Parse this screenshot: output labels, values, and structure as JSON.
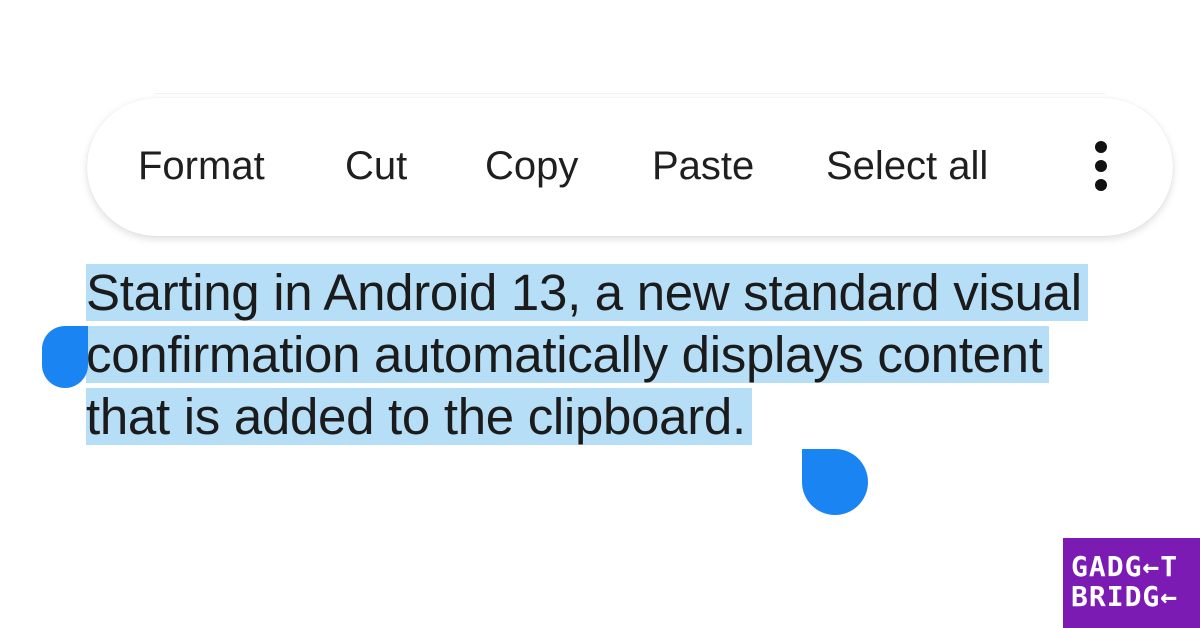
{
  "toolbar": {
    "buttons": [
      "Format",
      "Cut",
      "Copy",
      "Paste",
      "Select all"
    ],
    "overflow_icon": "more-vert-icon"
  },
  "content": {
    "lines": [
      "Starting in Android 13, a new standard visual",
      "confirmation automatically displays content",
      "that is added to the clipboard."
    ],
    "selection_color": "#b7def7",
    "handle_color": "#1a84f3"
  },
  "branding": {
    "logo_lines": [
      "GADG←T",
      "BRIDG←"
    ],
    "logo_color": "#7c1bb4"
  }
}
